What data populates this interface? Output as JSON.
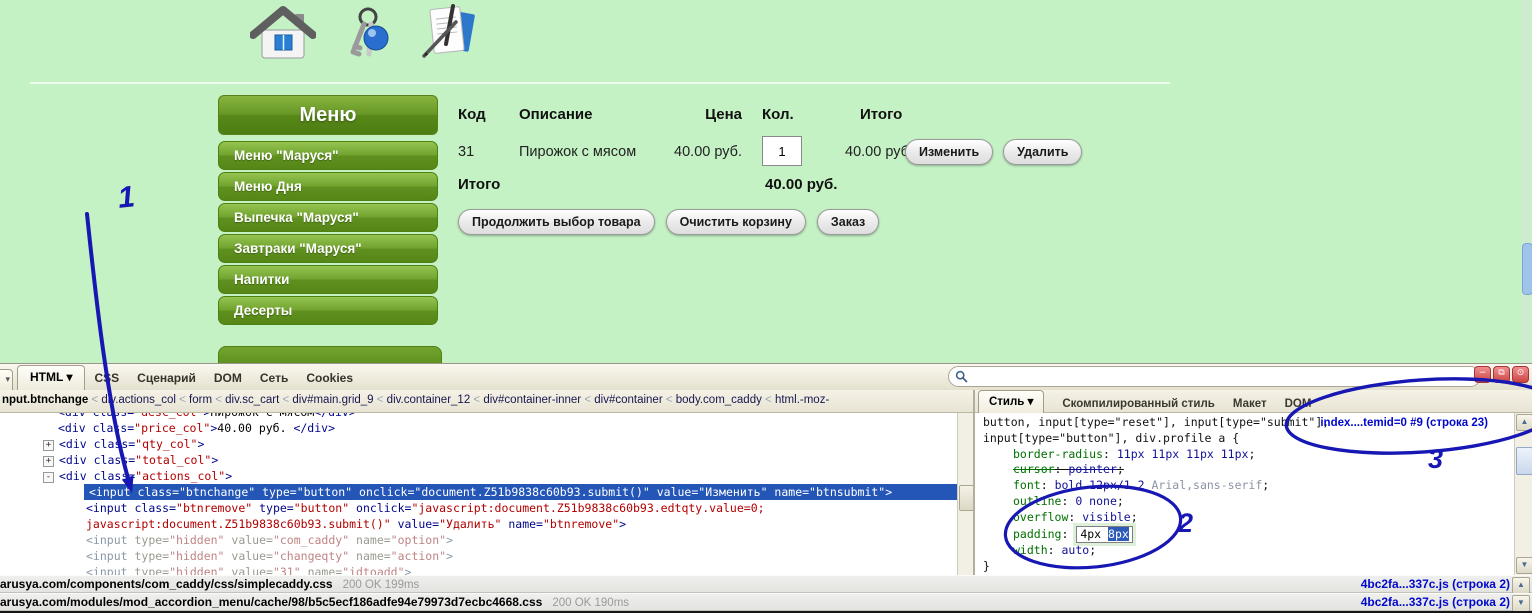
{
  "page": {
    "menu": {
      "title": "Меню",
      "items": [
        {
          "label": "Меню \"Маруся\""
        },
        {
          "label": "Меню Дня"
        },
        {
          "label": "Выпечка \"Маруся\""
        },
        {
          "label": "Завтраки \"Маруся\""
        },
        {
          "label": "Напитки"
        },
        {
          "label": "Десерты"
        }
      ]
    },
    "cart": {
      "headers": {
        "code": "Код",
        "desc": "Описание",
        "price": "Цена",
        "qty": "Кол.",
        "total": "Итого"
      },
      "item": {
        "code": "31",
        "desc": "Пирожок с мясом",
        "price": "40.00 руб.",
        "qty": "1",
        "total": "40.00 руб.",
        "edit_btn": "Изменить",
        "delete_btn": "Удалить"
      },
      "summary": {
        "label": "Итого",
        "value": "40.00 руб."
      },
      "action_buttons": [
        "Продолжить выбор товара",
        "Очистить корзину",
        "Заказ"
      ]
    }
  },
  "firebug": {
    "menu_caret": "▾",
    "main_tabs": [
      {
        "label": "HTML",
        "caret": "▾",
        "active": true
      },
      {
        "label": "CSS"
      },
      {
        "label": "Сценарий"
      },
      {
        "label": "DOM"
      },
      {
        "label": "Сеть"
      },
      {
        "label": "Cookies"
      }
    ],
    "window_buttons": [
      {
        "name": "minimize",
        "glyph": "−"
      },
      {
        "name": "detach",
        "glyph": "⧉"
      },
      {
        "name": "power",
        "glyph": "⊙"
      }
    ],
    "scroll": {
      "up": "▲",
      "down": "▼"
    },
    "breadcrumb": {
      "selected": "nput.btnchange",
      "separator": "<",
      "rest": [
        "div.actions_col",
        "form",
        "div.sc_cart",
        "div#main.grid_9",
        "div.container_12",
        "div#container-inner",
        "div#container",
        "body.com_caddy",
        "html.-moz-"
      ]
    },
    "html_tree": {
      "lines": [
        {
          "pad": 58,
          "tokens": [
            [
              "tag",
              "<div"
            ],
            [
              "attr",
              " class="
            ],
            [
              "val",
              "\"desc_col\""
            ],
            [
              "tag",
              ">"
            ],
            [
              "text",
              "Пирожок с мясом"
            ],
            [
              "tag",
              "</div>"
            ]
          ]
        },
        {
          "pad": 58,
          "tokens": [
            [
              "tag",
              "<div"
            ],
            [
              "attr",
              " class="
            ],
            [
              "val",
              "\"price_col\""
            ],
            [
              "tag",
              ">"
            ],
            [
              "text",
              "40.00 руб. "
            ],
            [
              "tag",
              "</div>"
            ]
          ]
        },
        {
          "pad": 43,
          "expander": "+",
          "tokens": [
            [
              "tag",
              "<div"
            ],
            [
              "attr",
              " class="
            ],
            [
              "val",
              "\"qty_col\""
            ],
            [
              "tag",
              ">"
            ]
          ]
        },
        {
          "pad": 43,
          "expander": "+",
          "tokens": [
            [
              "tag",
              "<div"
            ],
            [
              "attr",
              " class="
            ],
            [
              "val",
              "\"total_col\""
            ],
            [
              "tag",
              ">"
            ]
          ]
        },
        {
          "pad": 43,
          "expander": "-",
          "tokens": [
            [
              "tag",
              "<div"
            ],
            [
              "attr",
              " class="
            ],
            [
              "val",
              "\"actions_col\""
            ],
            [
              "tag",
              ">"
            ]
          ]
        },
        {
          "pad": 0,
          "selected": true,
          "tokens": [
            [
              "sel",
              "<input class=\"btnchange\" type=\"button\" onclick=\"document.Z51b9838c60b93.submit()\" value=\"Изменить\" name=\"btnsubmit\">"
            ]
          ]
        },
        {
          "pad": 86,
          "tokens": [
            [
              "tag",
              "<input"
            ],
            [
              "attr",
              " class="
            ],
            [
              "val",
              "\"btnremove\""
            ],
            [
              "attr",
              " type="
            ],
            [
              "val",
              "\"button\""
            ],
            [
              "attr",
              " onclick="
            ],
            [
              "val",
              "\"javascript:document.Z51b9838c60b93.edtqty.value=0;"
            ]
          ]
        },
        {
          "pad": 86,
          "tokens": [
            [
              "val",
              "javascript:document.Z51b9838c60b93.submit()\""
            ],
            [
              "attr",
              " value="
            ],
            [
              "val",
              "\"Удалить\""
            ],
            [
              "attr",
              " name="
            ],
            [
              "val",
              "\"btnremove\""
            ],
            [
              "tag",
              ">"
            ]
          ]
        },
        {
          "pad": 86,
          "tokens": [
            [
              "mtag",
              "<input"
            ],
            [
              "mattr",
              " type="
            ],
            [
              "mval",
              "\"hidden\""
            ],
            [
              "mattr",
              " value="
            ],
            [
              "mval",
              "\"com_caddy\""
            ],
            [
              "mattr",
              " name="
            ],
            [
              "mval",
              "\"option\""
            ],
            [
              "mtag",
              ">"
            ]
          ]
        },
        {
          "pad": 86,
          "tokens": [
            [
              "mtag",
              "<input"
            ],
            [
              "mattr",
              " type="
            ],
            [
              "mval",
              "\"hidden\""
            ],
            [
              "mattr",
              " value="
            ],
            [
              "mval",
              "\"changeqty\""
            ],
            [
              "mattr",
              " name="
            ],
            [
              "mval",
              "\"action\""
            ],
            [
              "mtag",
              ">"
            ]
          ]
        },
        {
          "pad": 86,
          "tokens": [
            [
              "mtag",
              "<input"
            ],
            [
              "mattr",
              " type="
            ],
            [
              "mval",
              "\"hidden\""
            ],
            [
              "mattr",
              " value="
            ],
            [
              "mval",
              "\"31\""
            ],
            [
              "mattr",
              " name="
            ],
            [
              "mval",
              "\"idtoadd\""
            ],
            [
              "mtag",
              ">"
            ]
          ]
        }
      ]
    },
    "style_panel": {
      "tabs": [
        {
          "label": "Стиль",
          "caret": "▾",
          "active": true
        },
        {
          "label": "Скомпилированный стиль"
        },
        {
          "label": "Макет"
        },
        {
          "label": "DOM"
        }
      ],
      "source_link": "index....temid=0 #9 (строка 23)",
      "rule": {
        "selector_line1": "button, input[type=\"reset\"], input[type=\"submit\"],",
        "selector_line2": "input[type=\"button\"], div.profile a {",
        "props": [
          {
            "name": "border-radius",
            "value": "11px 11px 11px 11px"
          },
          {
            "name": "cursor",
            "value": "pointer",
            "struck": true
          },
          {
            "name": "font",
            "value": "bold 12px/1.2 ",
            "value2": "Arial,sans-serif"
          },
          {
            "name": "outline",
            "value": "0 none"
          },
          {
            "name": "overflow",
            "value": "visible"
          },
          {
            "name": "padding",
            "editing": true,
            "edit_value_1": "4px",
            "edit_value_2": "8px"
          },
          {
            "name": "width",
            "value": "auto"
          }
        ],
        "close_brace": "}"
      }
    },
    "net_rows": [
      {
        "url": "arusya.com/components/com_caddy/css/simplecaddy.css",
        "status": "200 OK 199ms",
        "source": "4bc2fa...337c.js (строка 2)",
        "arrow": "up"
      },
      {
        "url": "arusya.com/modules/mod_accordion_menu/cache/98/b5c5ecf186adfe94e79973d7ecbc4668.css",
        "status": "200 OK 190ms",
        "source": "4bc2fa...337c.js (строка 2)",
        "arrow": "down"
      }
    ]
  },
  "annotations": {
    "n1": "1",
    "n2": "2",
    "n3": "3"
  }
}
